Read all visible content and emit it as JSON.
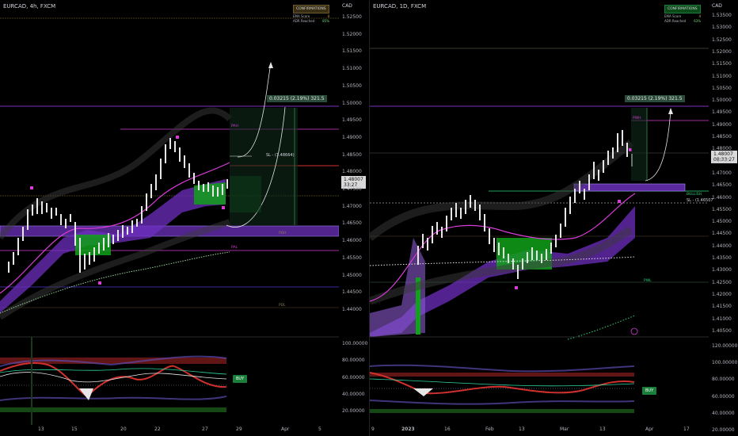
{
  "left": {
    "title": "EURCAD, 4h, FXCM",
    "confirmations": {
      "header": "CONFIRMATIONS",
      "rows": [
        {
          "label": "EMA Score",
          "value": "4"
        },
        {
          "label": "ADR Reached",
          "value": "85%"
        }
      ]
    },
    "currency": "CAD",
    "price_ticks": [
      "1.52500",
      "1.52000",
      "1.51500",
      "1.51000",
      "1.50500",
      "1.50000",
      "1.49500",
      "1.49000",
      "1.48500",
      "1.48000",
      "1.47500",
      "1.47000",
      "1.46500",
      "1.46000",
      "1.45500",
      "1.45000",
      "1.44500",
      "1.44000"
    ],
    "osc_ticks": [
      "100.00000",
      "80.00000",
      "60.00000",
      "40.00000",
      "20.00000"
    ],
    "x_labels": [
      "13",
      "15",
      "20",
      "22",
      "27",
      "29",
      "Apr",
      "5"
    ],
    "measure": "0.03215 (2.19%) 321.5",
    "last_price": "1.48007",
    "countdown": "33:27",
    "sl_label": "SL - (1.48664)",
    "buy_label": "BUY",
    "level_tags": [
      "PAH",
      "PAL",
      "PDH",
      "PDL"
    ],
    "colors": {
      "bg": "#000000",
      "up": "#e6e6e6",
      "down": "#e6e6e6",
      "purple": "#7b2fbf",
      "green": "#11a11a",
      "pink": "#d63cd6",
      "red": "#d0312d",
      "band": "#5b2a9e"
    }
  },
  "right": {
    "title": "EURCAD, 1D, FXCM",
    "confirmations": {
      "header": "CONFIRMATIONS",
      "rows": [
        {
          "label": "EMA Score",
          "value": "4"
        },
        {
          "label": "ADR Reached",
          "value": "63%"
        }
      ]
    },
    "currency": "CAD",
    "price_ticks": [
      "1.53500",
      "1.53000",
      "1.52500",
      "1.52000",
      "1.51500",
      "1.51000",
      "1.50500",
      "1.50000",
      "1.49500",
      "1.49000",
      "1.48500",
      "1.48000",
      "1.47500",
      "1.47000",
      "1.46500",
      "1.46000",
      "1.45500",
      "1.45000",
      "1.44500",
      "1.44000",
      "1.43500",
      "1.43000",
      "1.42500",
      "1.42000",
      "1.41500",
      "1.41000",
      "1.40500"
    ],
    "osc_ticks": [
      "120.00000",
      "100.00000",
      "80.00000",
      "60.00000",
      "40.00000",
      "20.00000"
    ],
    "x_labels": [
      "9",
      "2023",
      "16",
      "Feb",
      "13",
      "Mar",
      "13",
      "Apr",
      "17"
    ],
    "measure": "0.03215 (2.19%) 321.5",
    "last_price": "1.48007",
    "countdown": "08:33:27",
    "sl_label": "SL - (1.46507",
    "buy_label": "BUY",
    "level_tags": [
      "PWH",
      "PWL",
      "BULLISH"
    ]
  }
}
